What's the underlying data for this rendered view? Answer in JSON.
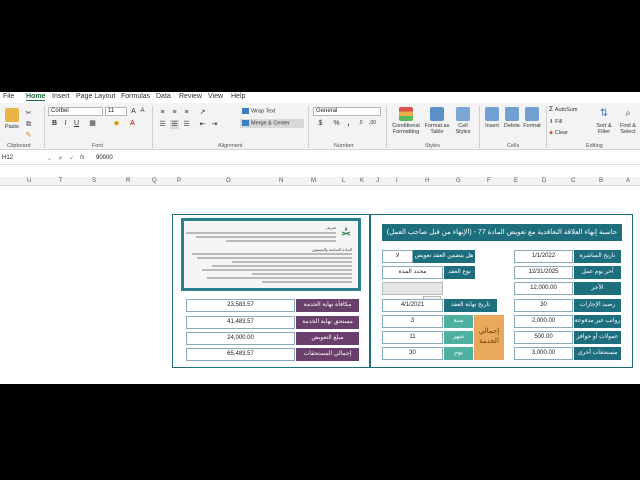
{
  "menu": [
    "File",
    "Home",
    "Insert",
    "Page Layout",
    "Formulas",
    "Data",
    "Review",
    "View",
    "Help"
  ],
  "ribbon": {
    "paste": "Paste",
    "clipboard": "Clipboard",
    "font_name": "Corbel",
    "font_size": "11",
    "font_group": "Font",
    "bold": "B",
    "italic": "I",
    "underline": "U",
    "wrap_text": "Wrap Text",
    "merge_center": "Merge & Center",
    "alignment": "Alignment",
    "number_format": "General",
    "number_group": "Number",
    "currency": "$",
    "percent": "%",
    "comma": ",",
    "cond_format": "Conditional Formatting",
    "format_table": "Format as Table",
    "cell_styles": "Cell Styles",
    "styles": "Styles",
    "insert": "Insert",
    "delete": "Delete",
    "format": "Format",
    "cells": "Cells",
    "autosum": "AutoSum",
    "fill": "Fill",
    "clear": "Clear",
    "sort_filter": "Sort & Filter",
    "find_select": "Find & Select",
    "editing": "Editing"
  },
  "formula": {
    "cell_ref": "H12",
    "fx": "fx",
    "value": "90000"
  },
  "columns": [
    "U",
    "T",
    "S",
    "R",
    "Q",
    "P",
    "O",
    "N",
    "M",
    "L",
    "K",
    "J",
    "I",
    "H",
    "G",
    "F",
    "E",
    "D",
    "C",
    "B",
    "A"
  ],
  "calc": {
    "title": "حاسبة إنهاء العلاقة التعاقدية مع تعويض المادة 77 - (الإنهاء من قبل صاحب العمل)",
    "start_date_label": "تاريخ المباشرة",
    "start_date": "1/1/2022",
    "last_day_label": "آخر يوم عمل",
    "last_day": "12/31/2025",
    "wage_label": "الأجر",
    "wage": "12,000.00",
    "leave_balance_label": "رصيد الإجازات",
    "leave_balance": "30",
    "unpaid_salary_label": "رواتب غير مدفوعة",
    "unpaid_salary": "2,000.00",
    "incentive_label": "عمولات أو حوافز",
    "incentive": "500.00",
    "other_label": "مستحقات أخرى",
    "other": "3,000.00",
    "fixed_term_q": "هل يتضمن العقد تعويض محدد؟",
    "fixed_term_a": "لا",
    "contract_type_label": "نوع العقد",
    "contract_type": "محدد المدة",
    "end_date_label": "تاريخ نهاية العقد",
    "end_date": "4/1/2021",
    "years_label": "سنة",
    "years": "3",
    "months_label": "شهر",
    "months": "11",
    "days_label": "يوم",
    "days": "30",
    "total_service": "إجمالي الخدمة",
    "eos_label": "مكافأة نهاية الخدمة",
    "eos": "23,583.57",
    "eos_due_label": "مستحق نهاية الخدمة",
    "eos_due": "41,483.57",
    "comp_label": "مبلغ التعويض",
    "comp": "24,000.00",
    "total_label": "إجمالي المستحقات",
    "total": "65,483.57"
  },
  "doc": {
    "heading": "تعريف",
    "section": "المادة السابعة والسبعون"
  }
}
